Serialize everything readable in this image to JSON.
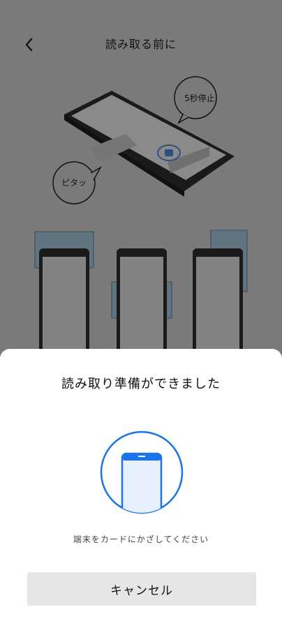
{
  "header": {
    "title": "読み取る前に",
    "back_icon": "chevron-left-icon"
  },
  "illustration": {
    "bubble_stop": "5秒停止",
    "bubble_tap": "ピタッ"
  },
  "sheet": {
    "title": "読み取り準備ができました",
    "message": "端末をカードにかざしてください",
    "cancel_label": "キャンセル",
    "accent_color": "#1a73e8"
  },
  "colors": {
    "overlay_bg": "#7a7a7a",
    "card_highlight": "#5f7480",
    "sheet_bg": "#ffffff",
    "button_bg": "#e6e6e6"
  }
}
